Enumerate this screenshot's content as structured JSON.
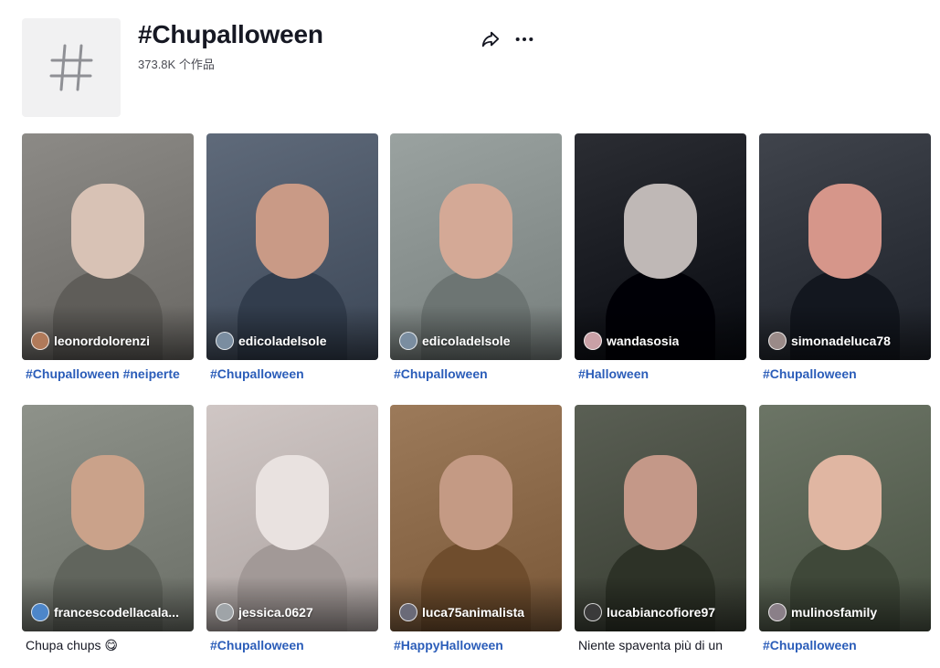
{
  "header": {
    "title": "#Chupalloween",
    "count": "373.8K 个作品",
    "thumb_icon": "hashtag-icon",
    "share_icon": "share-icon",
    "more_icon": "more-icon"
  },
  "videos": [
    {
      "author": "leonordolorenzi",
      "caption": "#Chupalloween #neiperte",
      "caption_is_tag": true,
      "bg": "#8c8a86",
      "face": "#d8c2b5",
      "avatar": "#b07a5a"
    },
    {
      "author": "edicoladelsole",
      "caption": "#Chupalloween",
      "caption_is_tag": true,
      "bg": "#5f6a7a",
      "face": "#c99a86",
      "avatar": "#7a8da0"
    },
    {
      "author": "edicoladelsole",
      "caption": "#Chupalloween",
      "caption_is_tag": true,
      "bg": "#9aa2a0",
      "face": "#d4a996",
      "avatar": "#7a8da0"
    },
    {
      "author": "wandasosia",
      "caption": "#Halloween",
      "caption_is_tag": true,
      "bg": "#2b2d33",
      "face": "#bfb8b6",
      "avatar": "#c9a0a6"
    },
    {
      "author": "simonadeluca78",
      "caption": "#Chupalloween",
      "caption_is_tag": true,
      "bg": "#40444c",
      "face": "#d6968a",
      "avatar": "#9a8a88"
    },
    {
      "author": "francescodellacala...",
      "caption": "Chupa chups 😋",
      "caption_is_tag": false,
      "bg": "#8e928a",
      "face": "#caa28a",
      "avatar": "#4d86c9"
    },
    {
      "author": "jessica.0627",
      "caption": "#Chupalloween",
      "caption_is_tag": true,
      "bg": "#cfc6c4",
      "face": "#e9e2e0",
      "avatar": "#9fa4a8"
    },
    {
      "author": "luca75animalista",
      "caption": "#HappyHalloween",
      "caption_is_tag": true,
      "bg": "#9c7a5a",
      "face": "#c49a84",
      "avatar": "#6a6a78"
    },
    {
      "author": "lucabiancofiore97",
      "caption": "Niente spaventa più di un",
      "caption_is_tag": false,
      "bg": "#5a5f54",
      "face": "#c49888",
      "avatar": "#3a3a3a"
    },
    {
      "author": "mulinosfamily",
      "caption": "#Chupalloween",
      "caption_is_tag": true,
      "bg": "#6c7566",
      "face": "#e0b6a2",
      "avatar": "#8a7f88"
    }
  ]
}
